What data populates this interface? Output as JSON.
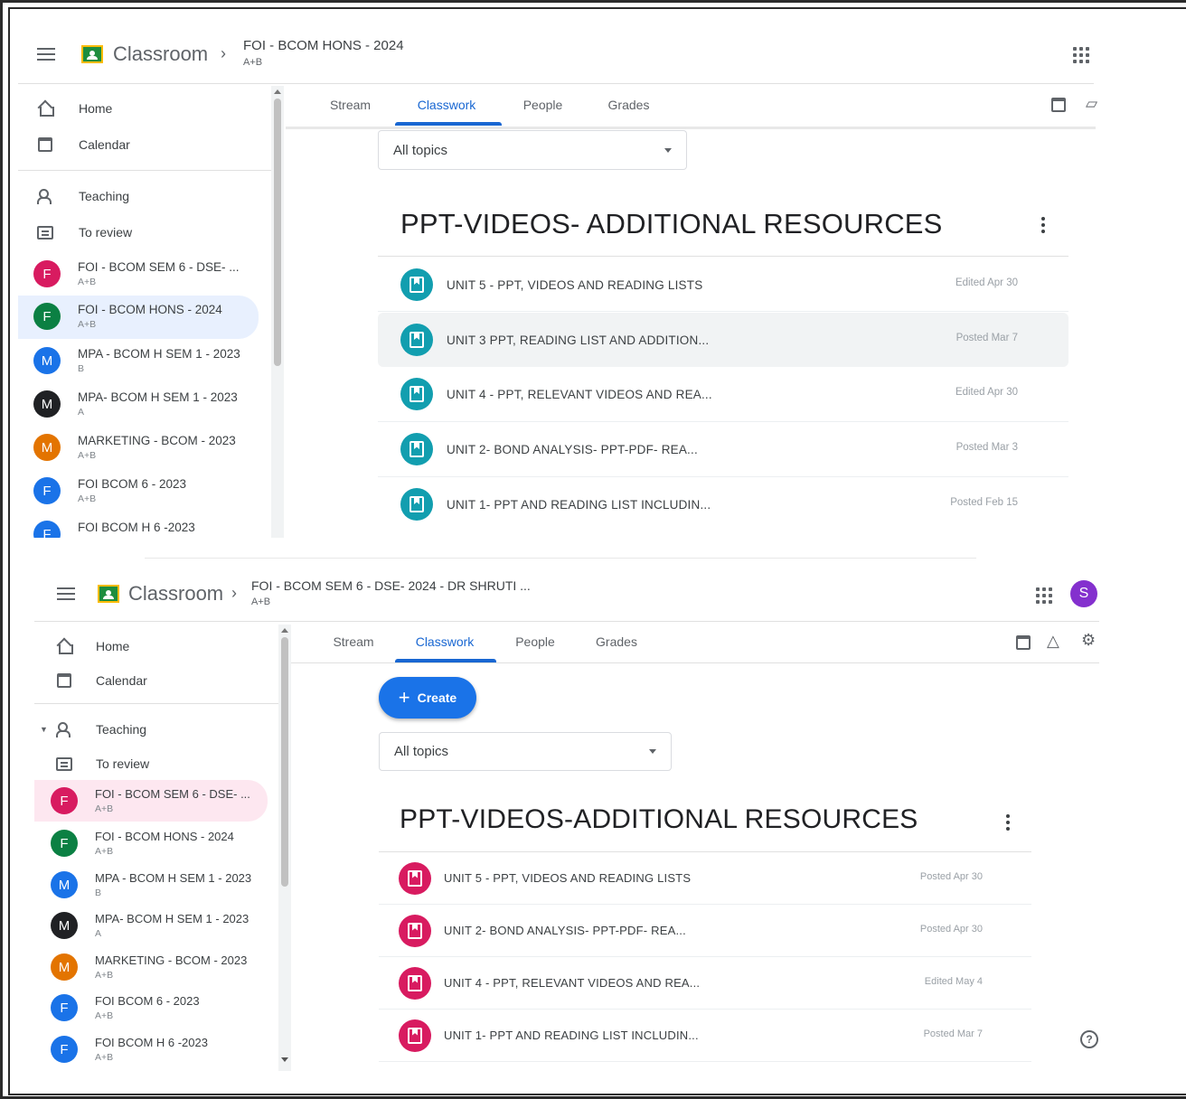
{
  "colors": {
    "accent_blue": "#1967d2",
    "teal_material": "#129eaf",
    "pink_material": "#d81b60",
    "avatar_pink": "#d81b60",
    "avatar_teal": "#0b8043",
    "avatar_blue": "#1a73e8",
    "avatar_black": "#202124",
    "avatar_orange": "#e37400",
    "avatar_purple": "#8430ce"
  },
  "screens": [
    {
      "header": {
        "app_name": "Classroom",
        "course_title": "FOI - BCOM HONS - 2024",
        "course_section": "A+B",
        "apps_icon": "apps-grid-icon"
      },
      "nav": {
        "home": "Home",
        "calendar": "Calendar",
        "teaching": "Teaching",
        "to_review": "To review"
      },
      "classes": [
        {
          "initial": "F",
          "name": "FOI - BCOM SEM 6 - DSE- ...",
          "section": "A+B",
          "color": "#d81b60"
        },
        {
          "initial": "F",
          "name": "FOI - BCOM HONS - 2024",
          "section": "A+B",
          "color": "#0b8043"
        },
        {
          "initial": "M",
          "name": "MPA - BCOM H SEM 1 - 2023",
          "section": "B",
          "color": "#1a73e8"
        },
        {
          "initial": "M",
          "name": "MPA- BCOM H SEM 1 - 2023",
          "section": "A",
          "color": "#202124"
        },
        {
          "initial": "M",
          "name": "MARKETING - BCOM - 2023",
          "section": "A+B",
          "color": "#e37400"
        },
        {
          "initial": "F",
          "name": "FOI BCOM 6 - 2023",
          "section": "A+B",
          "color": "#1a73e8"
        },
        {
          "initial": "F",
          "name": "FOI BCOM H 6 -2023",
          "section": "",
          "color": "#1a73e8"
        }
      ],
      "tabs": [
        "Stream",
        "Classwork",
        "People",
        "Grades"
      ],
      "active_tab": "Classwork",
      "topic_filter": "All topics",
      "topic_title": "PPT-VIDEOS- ADDITIONAL RESOURCES",
      "materials": [
        {
          "title": "UNIT 5 - PPT, VIDEOS AND READING LISTS",
          "date": "Edited Apr 30"
        },
        {
          "title": "UNIT 3 PPT, READING LIST AND ADDITION...",
          "date": "Posted Mar 7"
        },
        {
          "title": "UNIT 4 - PPT, RELEVANT VIDEOS AND REA...",
          "date": "Edited Apr 30"
        },
        {
          "title": "UNIT 2- BOND ANALYSIS- PPT-PDF- REA...",
          "date": "Posted Mar 3"
        },
        {
          "title": "UNIT 1- PPT AND READING LIST INCLUDIN...",
          "date": "Posted Feb 15"
        }
      ]
    },
    {
      "header": {
        "app_name": "Classroom",
        "course_title": "FOI - BCOM SEM 6 - DSE- 2024 - DR SHRUTI ...",
        "course_section": "A+B",
        "avatar_letter": "S"
      },
      "nav": {
        "home": "Home",
        "calendar": "Calendar",
        "teaching": "Teaching",
        "to_review": "To review"
      },
      "classes": [
        {
          "initial": "F",
          "name": "FOI - BCOM SEM 6 - DSE- ...",
          "section": "A+B",
          "color": "#d81b60"
        },
        {
          "initial": "F",
          "name": "FOI - BCOM HONS - 2024",
          "section": "A+B",
          "color": "#0b8043"
        },
        {
          "initial": "M",
          "name": "MPA - BCOM H SEM 1 - 2023",
          "section": "B",
          "color": "#1a73e8"
        },
        {
          "initial": "M",
          "name": "MPA- BCOM H SEM 1 - 2023",
          "section": "A",
          "color": "#202124"
        },
        {
          "initial": "M",
          "name": "MARKETING - BCOM - 2023",
          "section": "A+B",
          "color": "#e37400"
        },
        {
          "initial": "F",
          "name": "FOI BCOM 6 - 2023",
          "section": "A+B",
          "color": "#1a73e8"
        },
        {
          "initial": "F",
          "name": "FOI BCOM H 6 -2023",
          "section": "A+B",
          "color": "#1a73e8"
        }
      ],
      "tabs": [
        "Stream",
        "Classwork",
        "People",
        "Grades"
      ],
      "active_tab": "Classwork",
      "create_label": "Create",
      "topic_filter": "All topics",
      "topic_title": "PPT-VIDEOS-ADDITIONAL RESOURCES",
      "materials": [
        {
          "title": "UNIT 5 - PPT, VIDEOS AND READING LISTS",
          "date": "Posted Apr 30"
        },
        {
          "title": "UNIT 2- BOND ANALYSIS- PPT-PDF- REA...",
          "date": "Posted Apr 30"
        },
        {
          "title": "UNIT 4 - PPT, RELEVANT VIDEOS AND REA...",
          "date": "Edited May 4"
        },
        {
          "title": "UNIT 1- PPT AND READING LIST INCLUDIN...",
          "date": "Posted Mar 7"
        }
      ]
    }
  ]
}
